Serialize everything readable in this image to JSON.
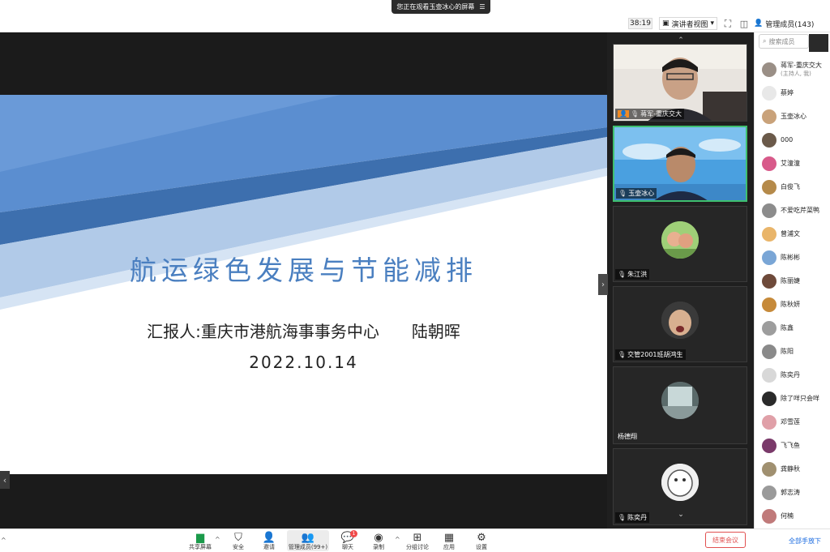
{
  "banner": {
    "text": "您正在观看玉壶冰心的屏幕",
    "menu_icon": "menu-icon"
  },
  "topbar": {
    "timer": "38:19",
    "view_mode": "演讲者视图",
    "members_label": "管理成员(143)"
  },
  "slide": {
    "title": "航运绿色发展与节能减排",
    "reporter": "汇报人:重庆市港航海事事务中心　　陆朝晖",
    "date": "2022.10.14"
  },
  "videos": [
    {
      "name": "蒋军-重庆交大"
    },
    {
      "name": "玉壶冰心"
    },
    {
      "name": "朱江洪"
    },
    {
      "name": "交管2001班胡鸿生"
    },
    {
      "name": "杨德翔"
    },
    {
      "name": "陈奕丹"
    }
  ],
  "members_panel": {
    "search_placeholder": "搜索成员",
    "items": [
      {
        "name": "蒋军-重庆交大",
        "sub": "(主持人, 我)",
        "color": "#9a8f86"
      },
      {
        "name": "蔡婷",
        "sub": "",
        "color": "#e8e8e8"
      },
      {
        "name": "玉壶冰心",
        "sub": "",
        "color": "#c9a27a"
      },
      {
        "name": "000",
        "sub": "",
        "color": "#6b5a4a"
      },
      {
        "name": "艾潼潼",
        "sub": "",
        "color": "#d85a8a"
      },
      {
        "name": "白俊飞",
        "sub": "",
        "color": "#b58a4a"
      },
      {
        "name": "不爱吃芹菜鸭",
        "sub": "",
        "color": "#8c8c8c"
      },
      {
        "name": "曾浦文",
        "sub": "",
        "color": "#e9b56a"
      },
      {
        "name": "陈彬彬",
        "sub": "",
        "color": "#7aa6d6"
      },
      {
        "name": "陈丽婕",
        "sub": "",
        "color": "#6e4a3a"
      },
      {
        "name": "陈秋妍",
        "sub": "",
        "color": "#c68a3a"
      },
      {
        "name": "陈鑫",
        "sub": "",
        "color": "#9d9d9d"
      },
      {
        "name": "陈阳",
        "sub": "",
        "color": "#8a8a8a"
      },
      {
        "name": "陈奕丹",
        "sub": "",
        "color": "#d8d8d8"
      },
      {
        "name": "除了咩只会咩",
        "sub": "",
        "color": "#2a2a2a"
      },
      {
        "name": "邓雪莲",
        "sub": "",
        "color": "#e0a0a8"
      },
      {
        "name": "飞飞鱼",
        "sub": "",
        "color": "#7a3a6a"
      },
      {
        "name": "龚静秋",
        "sub": "",
        "color": "#a09070"
      },
      {
        "name": "郭志涛",
        "sub": "",
        "color": "#9a9a9a"
      },
      {
        "name": "何楠",
        "sub": "",
        "color": "#c07a7a"
      }
    ]
  },
  "toolbar": {
    "share": "共享屏幕",
    "security": "安全",
    "invite": "邀请",
    "members": "管理成员(99+)",
    "chat": "聊天",
    "chat_badge": "1",
    "record": "录制",
    "breakout": "分组讨论",
    "apps": "应用",
    "settings": "设置",
    "end_meeting": "结束会议",
    "all_hands_down": "全部手放下"
  }
}
